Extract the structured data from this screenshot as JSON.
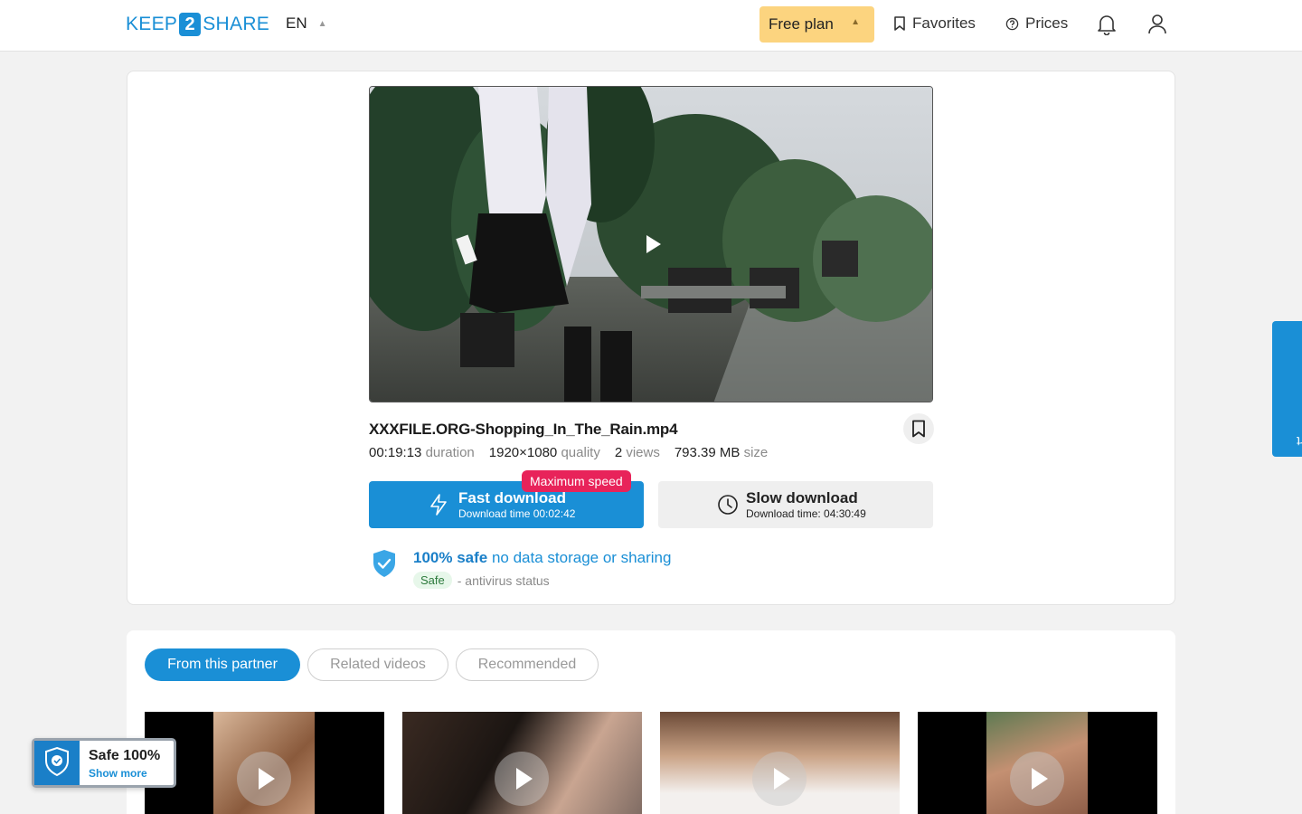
{
  "header": {
    "logo_left": "KEEP",
    "logo_num": "2",
    "logo_right": "SHARE",
    "language": "EN",
    "plan_label": "Free plan",
    "favorites_label": "Favorites",
    "prices_label": "Prices"
  },
  "file": {
    "name": "XXXFILE.ORG-Shopping_In_The_Rain.mp4",
    "duration_value": "00:19:13",
    "duration_label": "duration",
    "quality_value": "1920×1080",
    "quality_label": "quality",
    "views_value": "2",
    "views_label": "views",
    "size_value": "793.39 MB",
    "size_label": "size"
  },
  "downloads": {
    "fast_label": "Fast download",
    "fast_time": "Download time 00:02:42",
    "max_speed_badge": "Maximum speed",
    "slow_label": "Slow download",
    "slow_time": "Download time: 04:30:49"
  },
  "safety": {
    "title_bold": "100% safe",
    "title_rest": "no data storage or sharing",
    "status_pill": "Safe",
    "status_text": "- antivirus status"
  },
  "tabs": [
    {
      "label": "From this partner",
      "active": true
    },
    {
      "label": "Related videos",
      "active": false
    },
    {
      "label": "Recommended",
      "active": false
    }
  ],
  "support_label": "contact support",
  "safe_badge": {
    "title": "Safe 100%",
    "link": "Show more"
  },
  "colors": {
    "accent": "#1a8fd6",
    "plan": "#fcd47f",
    "badge": "#e8235a"
  }
}
